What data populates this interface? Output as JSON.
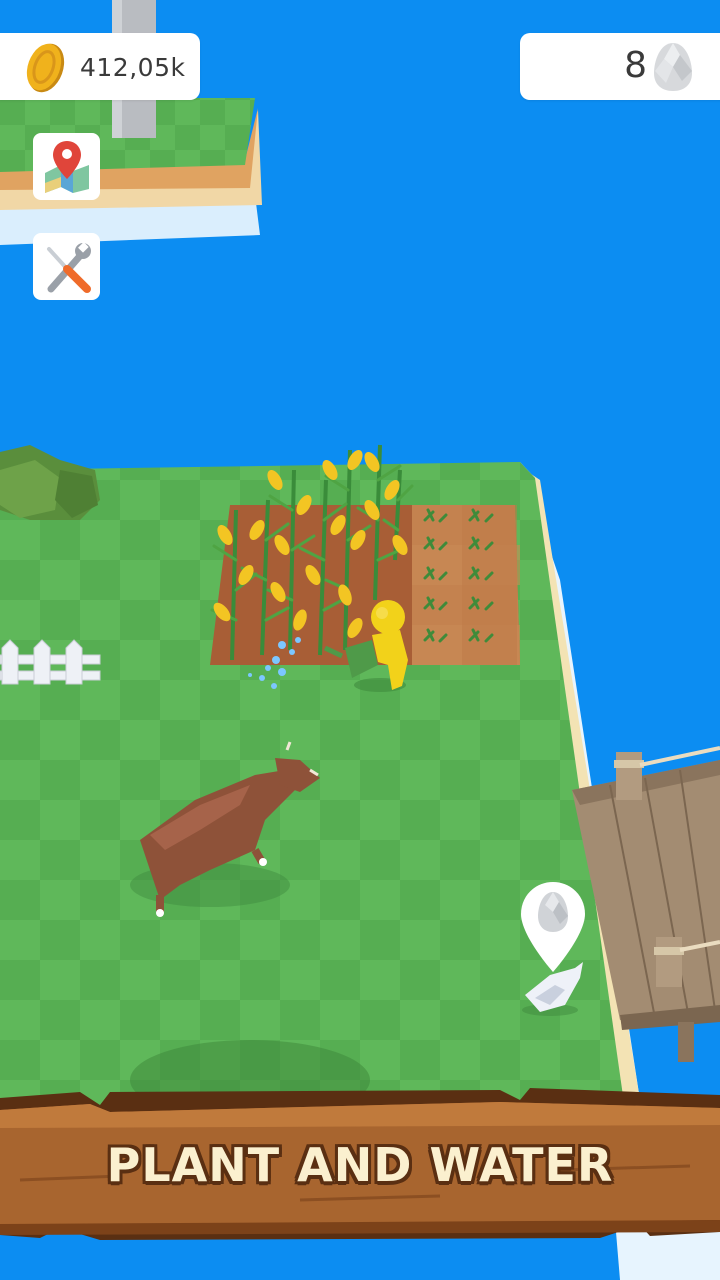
{
  "hud": {
    "coins": {
      "value": "412,05k",
      "icon": "coin-icon"
    },
    "eggs": {
      "value": "8",
      "icon": "egg-icon"
    }
  },
  "tools": [
    {
      "name": "map-button",
      "icon": "map-pin-icon"
    },
    {
      "name": "settings-button",
      "icon": "wrench-screwdriver-icon"
    }
  ],
  "marker": {
    "icon": "egg-icon"
  },
  "banner": {
    "text": "PLANT AND WATER"
  },
  "colors": {
    "water": "#0c8df2",
    "grass": "#5fb85a",
    "grass_alt": "#55ad52",
    "soil": "#b0643a",
    "banner_wood": "#9a5a2e",
    "banner_text": "#fbf0cf",
    "player": "#f2d21a",
    "coin": "#f0b21c"
  }
}
